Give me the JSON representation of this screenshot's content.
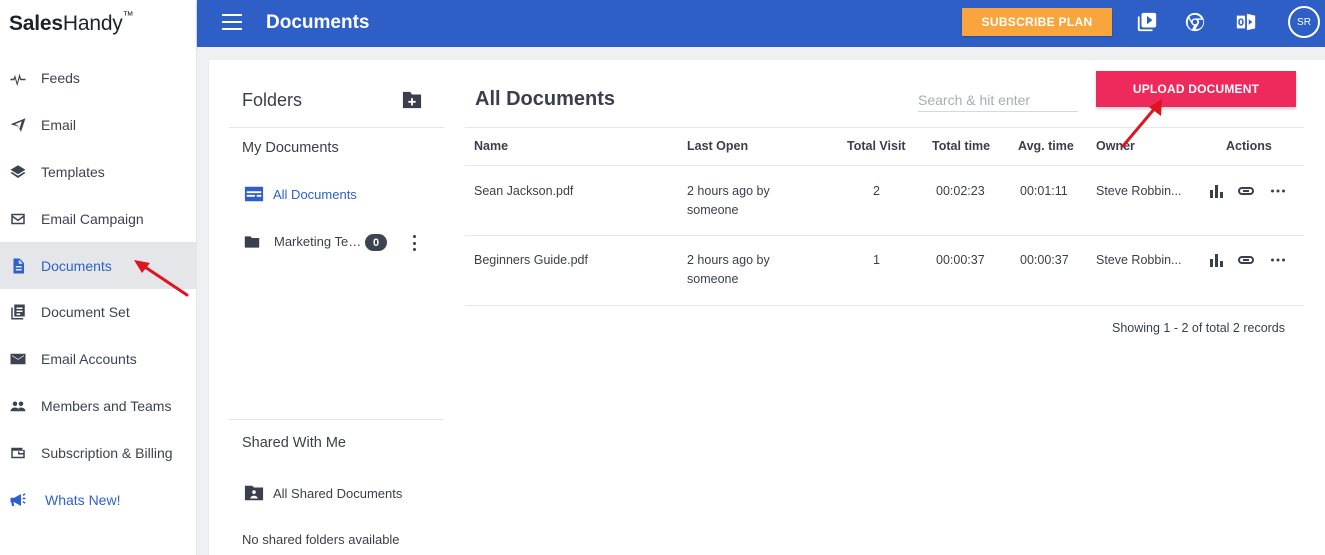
{
  "app": {
    "logo_bold": "Sales",
    "logo_light": "Handy",
    "logo_tm": "™"
  },
  "sidebar": {
    "items": [
      {
        "label": "Feeds",
        "icon": "pulse-icon"
      },
      {
        "label": "Email",
        "icon": "send-icon"
      },
      {
        "label": "Templates",
        "icon": "layers-icon"
      },
      {
        "label": "Email Campaign",
        "icon": "mail-campaign-icon"
      },
      {
        "label": "Documents",
        "icon": "document-icon",
        "active": true
      },
      {
        "label": "Document Set",
        "icon": "document-set-icon"
      },
      {
        "label": "Email Accounts",
        "icon": "envelope-icon"
      },
      {
        "label": "Members and Teams",
        "icon": "people-icon"
      },
      {
        "label": "Subscription & Billing",
        "icon": "wallet-icon"
      },
      {
        "label": "Whats New!",
        "icon": "megaphone-icon"
      }
    ]
  },
  "header": {
    "title": "Documents",
    "subscribe_label": "SUBSCRIBE PLAN",
    "icons": [
      "video-icon",
      "chrome-icon",
      "outlook-icon"
    ],
    "avatar_initials": "SR"
  },
  "folders": {
    "title": "Folders",
    "my_documents_label": "My Documents",
    "all_documents_label": "All Documents",
    "items": [
      {
        "label": "Marketing Team",
        "count": "0"
      }
    ],
    "shared_title": "Shared With Me",
    "all_shared_label": "All Shared Documents",
    "no_shared_text": "No shared folders available"
  },
  "documents": {
    "title": "All Documents",
    "search_placeholder": "Search & hit enter",
    "upload_label": "UPLOAD DOCUMENT",
    "columns": [
      "Name",
      "Last Open",
      "Total Visit",
      "Total time",
      "Avg. time",
      "Owner",
      "Actions"
    ],
    "rows": [
      {
        "name": "Sean Jackson.pdf",
        "last_open_1": "2 hours ago by",
        "last_open_2": "someone",
        "visits": "2",
        "total_time": "00:02:23",
        "avg_time": "00:01:11",
        "owner": "Steve Robbin..."
      },
      {
        "name": "Beginners Guide.pdf",
        "last_open_1": "2 hours ago by",
        "last_open_2": "someone",
        "visits": "1",
        "total_time": "00:00:37",
        "avg_time": "00:00:37",
        "owner": "Steve Robbin..."
      }
    ],
    "records_text": "Showing 1 - 2 of total 2 records"
  },
  "colors": {
    "brand_blue": "#2e5fc7",
    "subscribe_orange": "#f7a53c",
    "upload_pink": "#ee2a5c",
    "arrow_red": "#e0141e"
  }
}
